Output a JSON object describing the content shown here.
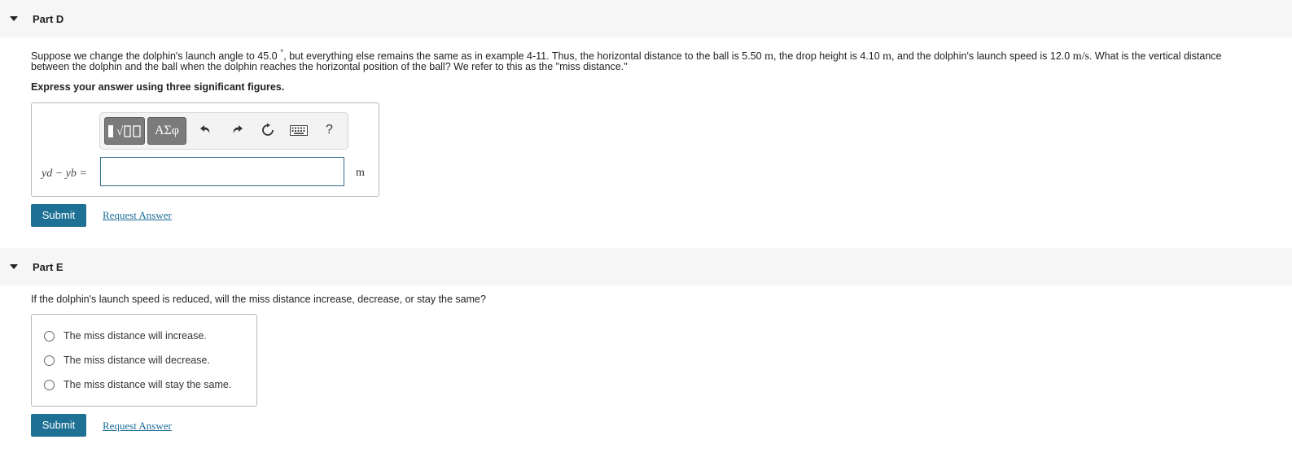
{
  "partD": {
    "title": "Part D",
    "question_line1_a": "Suppose we change the dolphin's launch angle to 45.0 ",
    "degree_symbol": "°",
    "question_line1_b": ", but everything else remains the same as in example 4-11. Thus, the horizontal distance to the ball is 5.50 ",
    "unit_m": "m",
    "question_line1_c": ", the drop height is 4.10 ",
    "question_line1_d": ", and the dolphin's launch speed is 12.0 ",
    "unit_ms": "m/s",
    "question_line1_e": ". What is the vertical distance",
    "question_line2": "between the dolphin and the ball when the dolphin reaches the horizontal position of the ball? We refer to this as the \"miss distance.\"",
    "instruction": "Express your answer using three significant figures.",
    "toolbar": {
      "templates_icon": "templates-icon",
      "greek_label": "ΑΣφ",
      "undo_icon": "undo-icon",
      "redo_icon": "redo-icon",
      "reset_icon": "reset-icon",
      "keyboard_icon": "keyboard-icon",
      "help_label": "?"
    },
    "answer_label": "yd − yb =",
    "answer_value": "",
    "answer_unit": "m",
    "submit_label": "Submit",
    "request_answer_label": "Request Answer"
  },
  "partE": {
    "title": "Part E",
    "question": "If the dolphin's launch speed is reduced, will the miss distance increase, decrease, or stay the same?",
    "choices": [
      {
        "label": "The miss distance will increase."
      },
      {
        "label": "The miss distance will decrease."
      },
      {
        "label": "The miss distance will stay the same."
      }
    ],
    "submit_label": "Submit",
    "request_answer_label": "Request Answer"
  },
  "colors": {
    "submit_bg": "#1e7095",
    "link": "#1d6d9a",
    "header_bg": "#f6f6f6",
    "input_border": "#2f6b8a"
  }
}
